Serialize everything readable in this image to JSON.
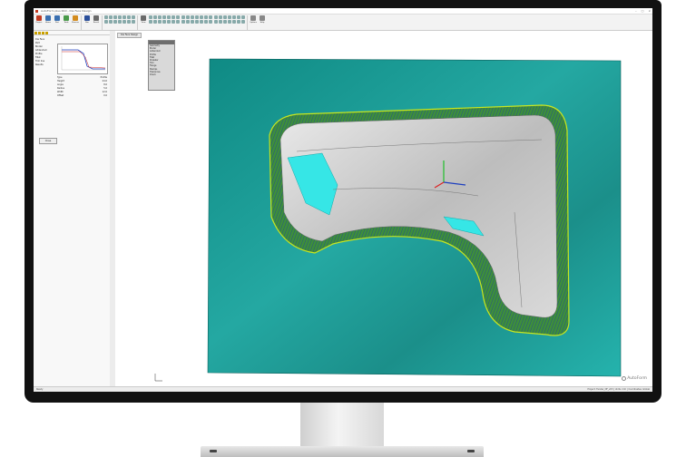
{
  "app": {
    "title": "AutoForm plus R10 - Die Face Design",
    "window_controls": [
      "–",
      "□",
      "×"
    ]
  },
  "ribbon": {
    "buttons": [
      {
        "label": "Project",
        "color": "#c23b22",
        "icon": "folder-icon"
      },
      {
        "label": "Home",
        "color": "#3a6fb0",
        "icon": "home-icon"
      },
      {
        "label": "Part",
        "color": "#3a6fb0",
        "icon": "part-icon"
      },
      {
        "label": "Tools",
        "color": "#4a9a4a",
        "icon": "tools-icon"
      },
      {
        "label": "Process",
        "color": "#d38b1e",
        "icon": "process-icon"
      },
      {
        "label": "Run",
        "color": "#2b4f9a",
        "icon": "run-icon"
      },
      {
        "label": "Result",
        "color": "#6a6a6a",
        "icon": "result-icon"
      },
      {
        "label": "View",
        "color": "#6a6a6a",
        "icon": "view-icon"
      }
    ],
    "right_labels": [
      "Options",
      "Help"
    ]
  },
  "left_panel": {
    "tree": [
      "Die Face",
      "Part",
      "Binder",
      "Addendum",
      "Profile",
      "Fillet",
      "Trim line",
      "Results"
    ],
    "form": {
      "rows": [
        {
          "label": "Type",
          "value": "Profile"
        },
        {
          "label": "Height",
          "value": "24.0"
        },
        {
          "label": "Angle",
          "value": "8.0"
        },
        {
          "label": "Radius",
          "value": "5.0"
        },
        {
          "label": "Width",
          "value": "12.0"
        },
        {
          "label": "Offset",
          "value": "0.0"
        }
      ]
    },
    "button_label": "Close"
  },
  "viewport": {
    "tab": "Die Face Design",
    "float_panel_rows": [
      "Geometry",
      "Binder",
      "Addendum",
      "Profile",
      "Fillet",
      "Drawbar",
      "Trim",
      "Flange",
      "Stamps",
      "Tolerances",
      "Check"
    ],
    "brand": "AutoForm",
    "colors": {
      "binder": "#1f9d96",
      "part": "#c8c8c8",
      "profile": "#3e8f3a",
      "highlight": "#36e6e6"
    }
  },
  "statusbar": {
    "left": "Ready",
    "right": "Project: Fender_DF_v03  |  Units: mm  |  Coordinates: Global"
  }
}
